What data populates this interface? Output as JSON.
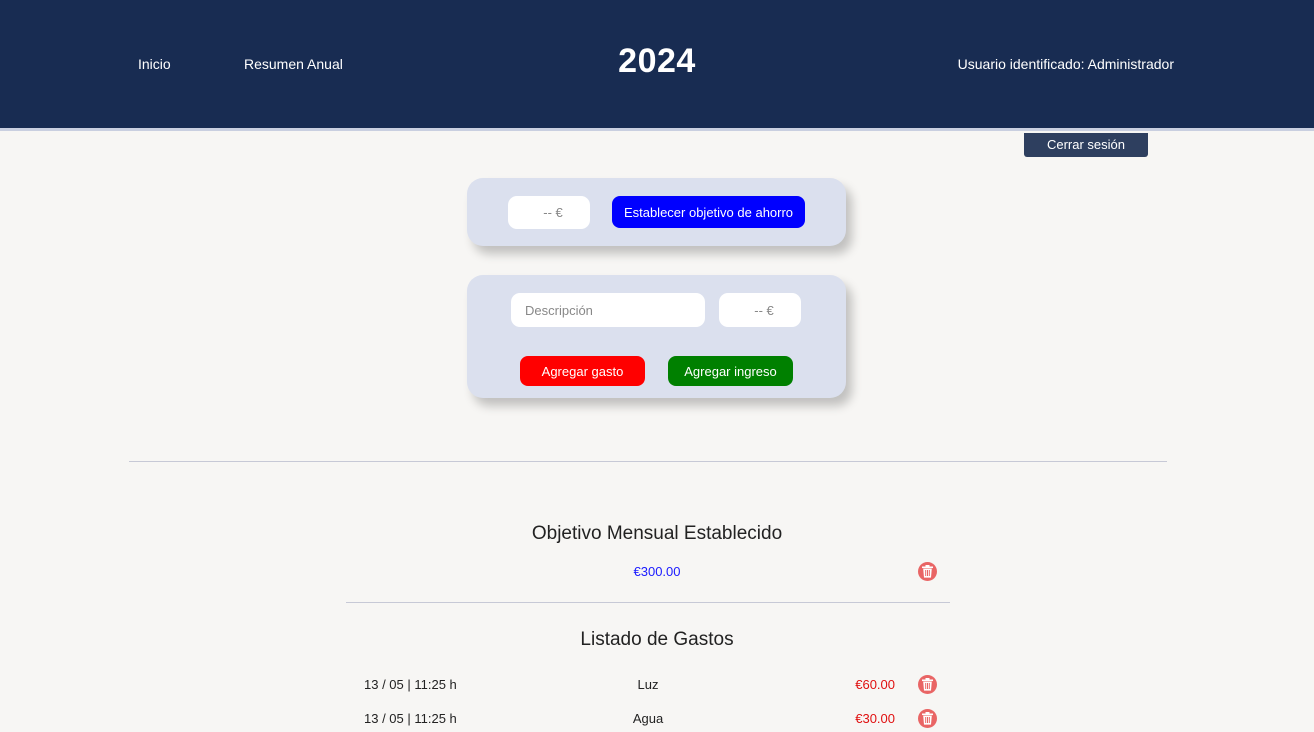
{
  "header": {
    "nav": [
      {
        "label": "Inicio"
      },
      {
        "label": "Resumen Anual"
      }
    ],
    "year": "2024",
    "user_label": "Usuario identificado: Administrador",
    "logout_label": "Cerrar sesión"
  },
  "goal_form": {
    "amount_placeholder": "-- €",
    "submit_label": "Establecer objetivo de ahorro"
  },
  "tx_form": {
    "description_placeholder": "Descripción",
    "amount_placeholder": "-- €",
    "expense_label": "Agregar gasto",
    "income_label": "Agregar ingreso"
  },
  "objective": {
    "title": "Objetivo Mensual Establecido",
    "value": "€300.00",
    "delete_icon": "trash-icon"
  },
  "expenses": {
    "title": "Listado de Gastos",
    "rows": [
      {
        "date": "13 / 05 | 11:25 h",
        "description": "Luz",
        "amount": "€60.00"
      },
      {
        "date": "13 / 05 | 11:25 h",
        "description": "Agua",
        "amount": "€30.00"
      }
    ]
  },
  "colors": {
    "header_bg": "#182c52",
    "goal_button": "#0000ff",
    "expense_button": "#ff0000",
    "income_button": "#008000",
    "expense_amount": "#e01010",
    "goal_value": "#1a1aff",
    "trash": "#e96565"
  }
}
